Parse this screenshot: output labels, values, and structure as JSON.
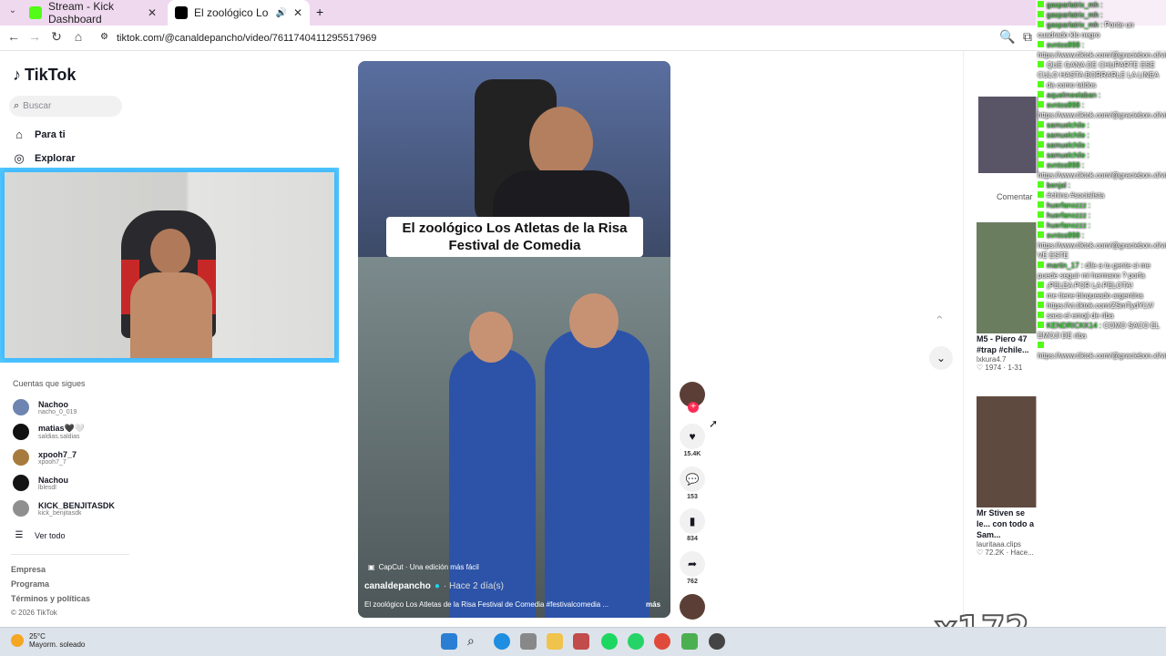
{
  "tabs": [
    {
      "title": "Stream - Kick Dashboard",
      "icon": "kick-icon"
    },
    {
      "title": "El zoológico Los Atletas de",
      "icon": "tiktok-icon"
    }
  ],
  "url": "tiktok.com/@canaldepancho/video/7611740411295517969",
  "sidebar": {
    "logo": "TikTok",
    "search_placeholder": "Buscar",
    "nav": [
      {
        "label": "Para ti",
        "icon": "home-icon"
      },
      {
        "label": "Explorar",
        "icon": "compass-icon"
      }
    ],
    "follows_title": "Cuentas que sigues",
    "accounts": [
      {
        "name": "Nachoo",
        "handle": "nacho_0_019",
        "color": "#6d85b0"
      },
      {
        "name": "matias🖤🤍",
        "handle": "saldias.saldias",
        "color": "#111111"
      },
      {
        "name": "xpooh7_7",
        "handle": "xpooh7_7",
        "color": "#a77a3e"
      },
      {
        "name": "Nachou",
        "handle": "lblesdl",
        "color": "#151515"
      },
      {
        "name": "KICK_BENJITASDK",
        "handle": "kick_benjitasdk",
        "color": "#8f8f8f"
      }
    ],
    "see_all": "Ver todo",
    "footer": [
      "Empresa",
      "Programa",
      "Términos y políticas"
    ],
    "copyright": "© 2026 TikTok"
  },
  "video": {
    "caption": "El zoológico Los Atletas de la Risa\nFestival de Comedia",
    "capcut": "CapCut · Una edición más fácil",
    "author": "canaldepancho",
    "ago": "· Hace 2 día(s)",
    "description": "El zoológico Los Atletas de la Risa Festival de Comedia #festivalcomedia ...",
    "more": "más"
  },
  "actions": {
    "likes": "15.4K",
    "comments": "153",
    "saves": "834",
    "shares": "762"
  },
  "right": {
    "comments_tab": "Comentar",
    "cards": [
      {
        "title": "M5 - Piero 47 #trap #chile...",
        "author": "lxkura4.7",
        "stats": "1974 · 1-31"
      },
      {
        "title": "Mr Stiven se le... con todo a Sam...",
        "author": "lauritaaa.clips",
        "stats": "72.2K · Hace..."
      }
    ]
  },
  "chat": [
    {
      "u": "gasparlatrix_mh",
      "t": ""
    },
    {
      "u": "gasparlatrix_mh",
      "t": ""
    },
    {
      "u": "gasparlatrix_mh",
      "t": "Ponte un cuadrado klo negro"
    },
    {
      "u": "svntos898",
      "t": "https://www.tiktok.com/@graciebon.xl/video/7595349831875415351"
    },
    {
      "u": "",
      "t": "QUE GANA DE CHUPARTE ESE CULO HASTA BORRARLE LA LINEA"
    },
    {
      "u": "",
      "t": "da como taldos"
    },
    {
      "u": "aquelmeelaban",
      "t": ""
    },
    {
      "u": "svntos898",
      "t": "https://www.tiktok.com/@graciebon.xl/video/7595349831875415351"
    },
    {
      "u": "samuelchile",
      "t": ""
    },
    {
      "u": "samuelchile",
      "t": ""
    },
    {
      "u": "samuelchile",
      "t": ""
    },
    {
      "u": "samuelchile",
      "t": ""
    },
    {
      "u": "svntos898",
      "t": "https://www.tiktok.com/@graciebon.xl/video/7595349831875415351"
    },
    {
      "u": "benjal",
      "t": ""
    },
    {
      "u": "",
      "t": "#china #socialista"
    },
    {
      "u": "huerfanozzz",
      "t": ""
    },
    {
      "u": "huerfanozzz",
      "t": ""
    },
    {
      "u": "huerfanozzz",
      "t": ""
    },
    {
      "u": "svntos898",
      "t": "https://www.tiktok.com/@graciebon.xl/video/7595349831875415351 VE ESTE"
    },
    {
      "u": "martin_17",
      "t": "dile a tu gente si me puede seguir mi hermano ? porfa"
    },
    {
      "u": "",
      "t": "¡PELEA POR LA PELOTA!"
    },
    {
      "u": "",
      "t": "me tiene bloqueado argentina"
    },
    {
      "u": "",
      "t": "https://vt.tiktok.com/ZSmTydYLV/"
    },
    {
      "u": "",
      "t": "saca el emoji de riba"
    },
    {
      "u": "KENDRICKK14",
      "t": "COMO SACO EL EMOJI DE riba"
    },
    {
      "u": "",
      "t": "https://www.tiktok.com/@graciebon.xl/video/7595349831875415351"
    }
  ],
  "taskbar": {
    "temp": "25°C",
    "weather": "Mayorm. soleado"
  },
  "overlay_count": "x172",
  "colors": {
    "tiktok_red": "#fe2c55",
    "kick_green": "#53fc18",
    "chat_user": "#3bd13b"
  }
}
